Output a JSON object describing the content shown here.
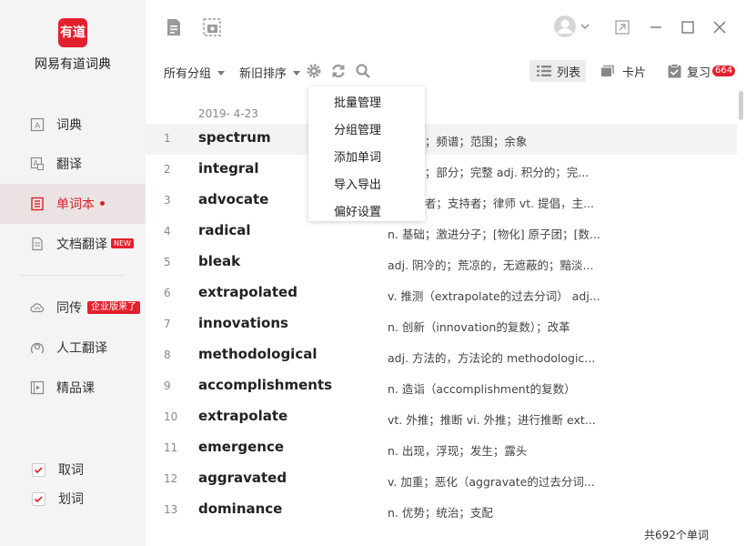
{
  "app": {
    "logo_text": "有道",
    "name": "网易有道词典"
  },
  "sidebar": {
    "items": [
      {
        "label": "词典"
      },
      {
        "label": "翻译"
      },
      {
        "label": "单词本"
      },
      {
        "label": "文档翻译",
        "badge": "NEW"
      },
      {
        "label": "同传",
        "badge": "企业版来了"
      },
      {
        "label": "人工翻译"
      },
      {
        "label": "精品课"
      }
    ],
    "checks": [
      {
        "label": "取词",
        "checked": true
      },
      {
        "label": "划词",
        "checked": true
      }
    ]
  },
  "toolbar": {
    "group_label": "所有分组",
    "sort_label": "新旧排序",
    "list_label": "列表",
    "card_label": "卡片",
    "review_label": "复习",
    "review_count": "664"
  },
  "dropdown": {
    "items": [
      "批量管理",
      "分组管理",
      "添加单词",
      "导入导出",
      "偏好设置"
    ]
  },
  "list": {
    "date": "2019- 4-23",
    "rows": [
      {
        "num": "1",
        "word": "spectrum",
        "def": "n. 光谱；频谱；范围；余象"
      },
      {
        "num": "2",
        "word": "integral",
        "def": "n. 积分；部分；完整  adj. 积分的；完..."
      },
      {
        "num": "3",
        "word": "advocate",
        "def": "n. 提倡者；支持者；律师  vt. 提倡，主..."
      },
      {
        "num": "4",
        "word": "radical",
        "def": "n. 基础；激进分子；[物化] 原子团；[数..."
      },
      {
        "num": "5",
        "word": "bleak",
        "def": "adj. 阴冷的；荒凉的，无遮蔽的；黯淡..."
      },
      {
        "num": "6",
        "word": "extrapolated",
        "def": "v. 推测（extrapolate的过去分词）  adj..."
      },
      {
        "num": "7",
        "word": "innovations",
        "def": "n. 创新（innovation的复数）；改革"
      },
      {
        "num": "8",
        "word": "methodological",
        "def": "adj. 方法的，方法论的  methodologic..."
      },
      {
        "num": "9",
        "word": "accomplishments",
        "def": "n. 造诣（accomplishment的复数）"
      },
      {
        "num": "10",
        "word": "extrapolate",
        "def": "vt. 外推；推断  vi. 外推；进行推断  ext..."
      },
      {
        "num": "11",
        "word": "emergence",
        "def": "n. 出现，浮现；发生；露头"
      },
      {
        "num": "12",
        "word": "aggravated",
        "def": "v. 加重；恶化（aggravate的过去分词..."
      },
      {
        "num": "13",
        "word": "dominance",
        "def": "n. 优势；统治；支配"
      }
    ],
    "total": "共692个单词"
  },
  "colors": {
    "accent": "#e3202d",
    "sidebar_bg": "#f4f4f4"
  }
}
